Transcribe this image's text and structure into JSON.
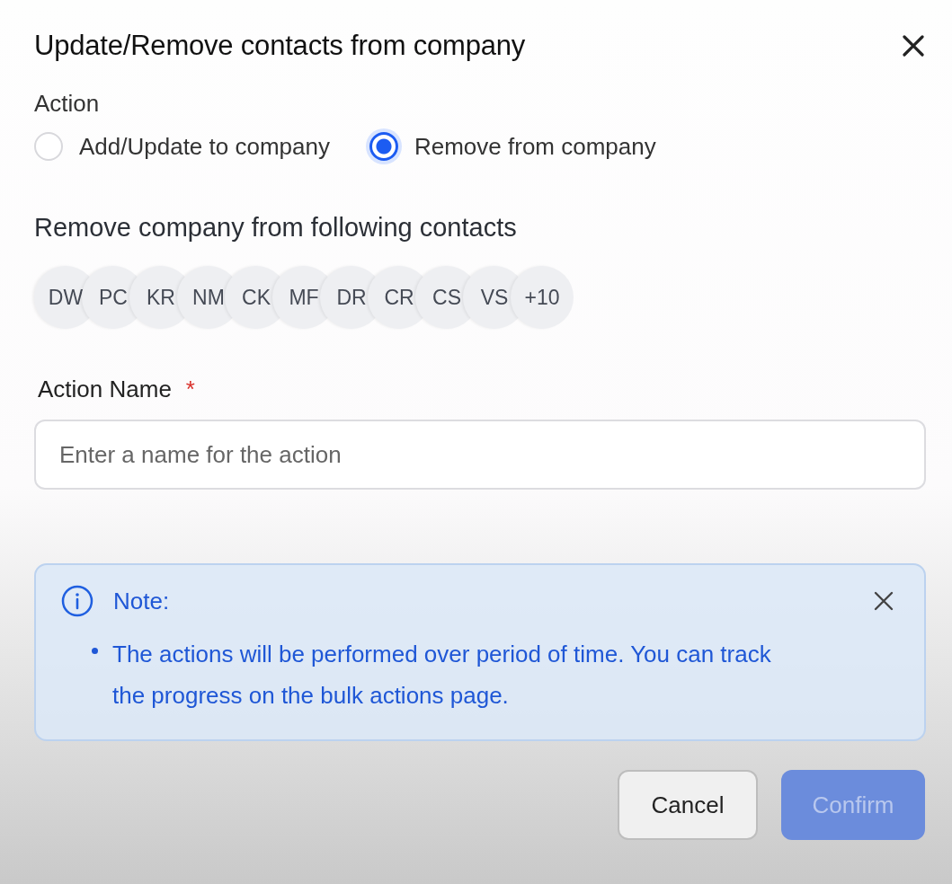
{
  "dialog": {
    "title": "Update/Remove contacts from company"
  },
  "action": {
    "label": "Action",
    "options": [
      {
        "label": "Add/Update to company",
        "selected": false
      },
      {
        "label": "Remove from company",
        "selected": true
      }
    ]
  },
  "contacts": {
    "heading": "Remove company from following contacts",
    "avatars": [
      "DW",
      "PC",
      "KR",
      "NM",
      "CK",
      "MF",
      "DR",
      "CR",
      "CS",
      "VS"
    ],
    "more": "+10"
  },
  "action_name": {
    "label": "Action Name",
    "required_mark": "*",
    "placeholder": "Enter a name for the action"
  },
  "note": {
    "title": "Note:",
    "items": [
      "The actions will be performed over period of time. You can track the progress on the bulk actions page."
    ]
  },
  "buttons": [
    {
      "label": "Cancel",
      "kind": "secondary",
      "disabled": false
    },
    {
      "label": "Confirm",
      "kind": "primary",
      "disabled": true
    }
  ]
}
